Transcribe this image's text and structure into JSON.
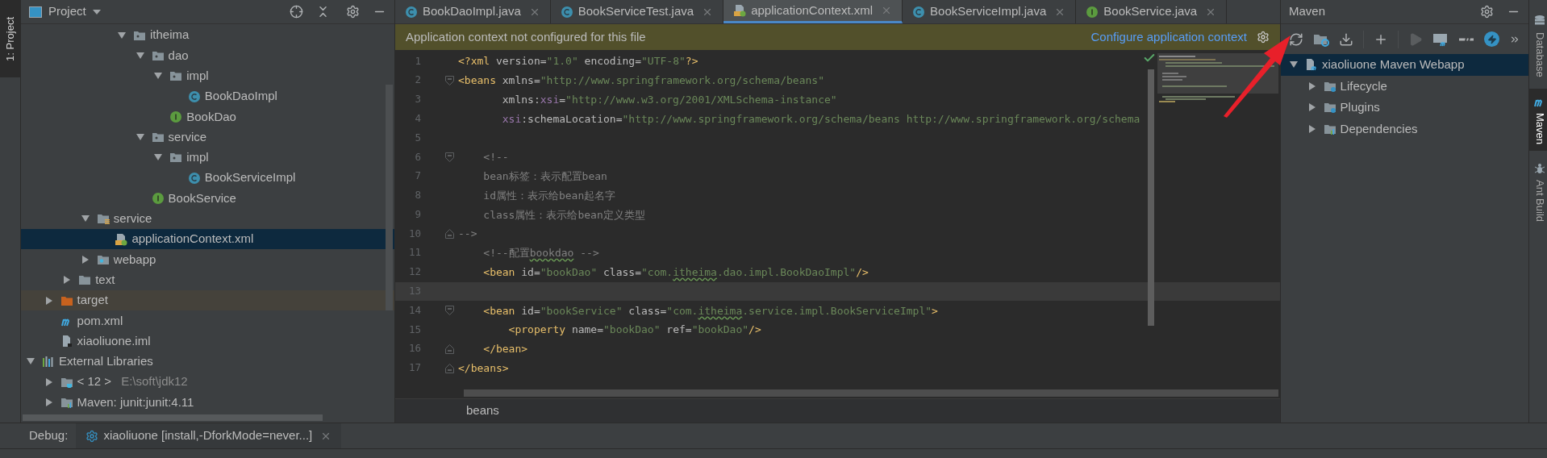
{
  "left_stripe": [
    {
      "label": "1: Project",
      "selected": true
    }
  ],
  "project": {
    "title": "Project",
    "tree": [
      {
        "children": [
          {
            "children": [
              {
                "children": [
                  {
                    "children": [
                      {
                        "children": [
                          {
                            "label": "itheima",
                            "kind": "package",
                            "expanded": true,
                            "selected": false,
                            "children": [
                              {
                                "label": "dao",
                                "kind": "package",
                                "expanded": true,
                                "selected": false,
                                "children": [
                                  {
                                    "label": "impl",
                                    "kind": "package",
                                    "expanded": true,
                                    "selected": false,
                                    "children": [
                                      {
                                        "label": "BookDaoImpl",
                                        "kind": "class",
                                        "selected": false
                                      }
                                    ]
                                  },
                                  {
                                    "label": "BookDao",
                                    "kind": "interface",
                                    "selected": false
                                  }
                                ]
                              },
                              {
                                "label": "service",
                                "kind": "package",
                                "expanded": true,
                                "selected": false,
                                "children": [
                                  {
                                    "label": "impl",
                                    "kind": "package",
                                    "expanded": true,
                                    "selected": false,
                                    "children": [
                                      {
                                        "label": "BookServiceImpl",
                                        "kind": "class",
                                        "selected": false
                                      }
                                    ]
                                  }
                                ]
                              },
                              {
                                "label": "BookService",
                                "kind": "interface",
                                "selected": false
                              }
                            ]
                          }
                        ]
                      }
                    ]
                  },
                  {
                    "label": "service",
                    "kind": "resources",
                    "expanded": true,
                    "selected": false,
                    "children": [
                      {
                        "label": "applicationContext.xml",
                        "kind": "xml",
                        "selected": true
                      }
                    ]
                  },
                  {
                    "label": "webapp",
                    "kind": "webapp",
                    "expanded": false,
                    "selected": false
                  }
                ]
              },
              {
                "label": "text",
                "kind": "folder",
                "expanded": false,
                "selected": false
              }
            ]
          },
          {
            "label": "target",
            "kind": "excluded",
            "expanded": false,
            "selected": false
          },
          {
            "label": "pom.xml",
            "kind": "maven",
            "selected": false
          },
          {
            "label": "xiaoliuone.iml",
            "kind": "file",
            "selected": false
          }
        ]
      },
      {
        "label": "External Libraries",
        "kind": "library",
        "expanded": true,
        "selected": false,
        "children": [
          {
            "label": "< 12 >",
            "detail": "E:\\soft\\jdk12",
            "kind": "sdk",
            "expanded": false,
            "selected": false
          },
          {
            "label": "Maven: junit:junit:4.11",
            "kind": "maven-lib",
            "expanded": false,
            "selected": false
          }
        ]
      }
    ]
  },
  "tabs": [
    {
      "label": "BookDaoImpl.java",
      "kind": "class",
      "selected": false
    },
    {
      "label": "BookServiceTest.java",
      "kind": "class",
      "selected": false
    },
    {
      "label": "applicationContext.xml",
      "kind": "xml",
      "selected": true
    },
    {
      "label": "BookServiceImpl.java",
      "kind": "class",
      "selected": false
    },
    {
      "label": "BookService.java",
      "kind": "interface",
      "selected": false
    }
  ],
  "banner": {
    "message": "Application context not configured for this file",
    "link": "Configure application context"
  },
  "editor": {
    "breadcrumb": "beans",
    "lines": [
      {
        "number": "1",
        "kind": "plain",
        "current": false,
        "tokens": [
          {
            "text": "<?xml",
            "kind": "tag"
          },
          {
            "text": " version=",
            "kind": "attr"
          },
          {
            "text": "\"1.0\"",
            "kind": "value"
          },
          {
            "text": " encoding=",
            "kind": "attr"
          },
          {
            "text": "\"UTF-8\"",
            "kind": "value"
          },
          {
            "text": "?>",
            "kind": "tag"
          }
        ]
      },
      {
        "number": "2",
        "kind": "fold-start",
        "current": false,
        "tokens": [
          {
            "text": "<beans",
            "kind": "tag"
          },
          {
            "text": " xmlns=",
            "kind": "attr"
          },
          {
            "text": "\"http://www.springframework.org/schema/beans\"",
            "kind": "value"
          }
        ]
      },
      {
        "number": "3",
        "kind": "plain",
        "current": false,
        "tokens": [
          {
            "text": "       xmlns:",
            "kind": "attr"
          },
          {
            "text": "xsi",
            "kind": "ns"
          },
          {
            "text": "=",
            "kind": "attr"
          },
          {
            "text": "\"http://www.w3.org/2001/XMLSchema-instance\"",
            "kind": "value"
          }
        ]
      },
      {
        "number": "4",
        "kind": "plain",
        "current": false,
        "tokens": [
          {
            "text": "       xsi",
            "kind": "ns"
          },
          {
            "text": ":schemaLocation=",
            "kind": "attr"
          },
          {
            "text": "\"http://www.springframework.org/schema/beans http://www.springframework.org/schema",
            "kind": "value"
          }
        ]
      },
      {
        "number": "5",
        "kind": "plain",
        "current": false
      },
      {
        "number": "6",
        "kind": "fold-start",
        "current": false,
        "tokens": [
          {
            "text": "    <!--",
            "kind": "comment"
          }
        ]
      },
      {
        "number": "7",
        "kind": "plain",
        "current": false,
        "tokens": [
          {
            "text": "    bean标签：表示配置bean",
            "kind": "comment"
          }
        ]
      },
      {
        "number": "8",
        "kind": "plain",
        "current": false,
        "tokens": [
          {
            "text": "    id属性：表示给bean起名字",
            "kind": "comment"
          }
        ]
      },
      {
        "number": "9",
        "kind": "plain",
        "current": false,
        "tokens": [
          {
            "text": "    class属性：表示给bean定义类型",
            "kind": "comment"
          }
        ]
      },
      {
        "number": "10",
        "kind": "fold-end",
        "current": false,
        "tokens": [
          {
            "text": "-->",
            "kind": "comment"
          }
        ]
      },
      {
        "number": "11",
        "kind": "plain",
        "current": false,
        "tokens": [
          {
            "text": "    <!--配置",
            "kind": "comment"
          },
          {
            "text": "bookdao",
            "kind": "comment-typo"
          },
          {
            "text": " -->",
            "kind": "comment"
          }
        ]
      },
      {
        "number": "12",
        "kind": "plain",
        "current": false,
        "tokens": [
          {
            "text": "    <bean",
            "kind": "tag"
          },
          {
            "text": " id=",
            "kind": "attr"
          },
          {
            "text": "\"bookDao\"",
            "kind": "value"
          },
          {
            "text": " class=",
            "kind": "attr"
          },
          {
            "text": "\"com.",
            "kind": "value"
          },
          {
            "text": "itheima",
            "kind": "value-typo"
          },
          {
            "text": ".dao.impl.BookDaoImpl\"",
            "kind": "value"
          },
          {
            "text": "/>",
            "kind": "tag"
          }
        ]
      },
      {
        "number": "13",
        "kind": "plain",
        "current": true
      },
      {
        "number": "14",
        "kind": "fold-start",
        "current": false,
        "tokens": [
          {
            "text": "    <bean",
            "kind": "tag"
          },
          {
            "text": " id=",
            "kind": "attr"
          },
          {
            "text": "\"bookService\"",
            "kind": "value"
          },
          {
            "text": " class=",
            "kind": "attr"
          },
          {
            "text": "\"com.",
            "kind": "value"
          },
          {
            "text": "itheima",
            "kind": "value-typo"
          },
          {
            "text": ".service.impl.BookServiceImpl\"",
            "kind": "value"
          },
          {
            "text": ">",
            "kind": "tag"
          }
        ]
      },
      {
        "number": "15",
        "kind": "plain",
        "current": false,
        "tokens": [
          {
            "text": "        <property",
            "kind": "tag"
          },
          {
            "text": " name=",
            "kind": "attr"
          },
          {
            "text": "\"bookDao\"",
            "kind": "value"
          },
          {
            "text": " ref=",
            "kind": "attr"
          },
          {
            "text": "\"bookDao\"",
            "kind": "value"
          },
          {
            "text": "/>",
            "kind": "tag"
          }
        ]
      },
      {
        "number": "16",
        "kind": "fold-end",
        "current": false,
        "tokens": [
          {
            "text": "    </bean>",
            "kind": "tag"
          }
        ]
      },
      {
        "number": "17",
        "kind": "fold-end",
        "current": false,
        "tokens": [
          {
            "text": "</beans>",
            "kind": "tag"
          }
        ]
      }
    ]
  },
  "maven": {
    "title": "Maven",
    "tree": [
      {
        "label": "xiaoliuone Maven Webapp",
        "kind": "maven-project",
        "expanded": true,
        "selected": true,
        "children": [
          {
            "label": "Lifecycle",
            "kind": "gear-folder",
            "expanded": false,
            "selected": false
          },
          {
            "label": "Plugins",
            "kind": "gear-folder",
            "expanded": false,
            "selected": false
          },
          {
            "label": "Dependencies",
            "kind": "maven-lib",
            "expanded": false,
            "selected": false
          }
        ]
      }
    ]
  },
  "right_stripe": [
    {
      "label": "Database",
      "kind": "database",
      "selected": false
    },
    {
      "label": "Maven",
      "kind": "maven",
      "selected": true
    },
    {
      "label": "Ant Build",
      "kind": "ant",
      "selected": false
    }
  ],
  "debug": {
    "label": "Debug:",
    "tab": "xiaoliuone [install,-DforkMode=never...]"
  }
}
